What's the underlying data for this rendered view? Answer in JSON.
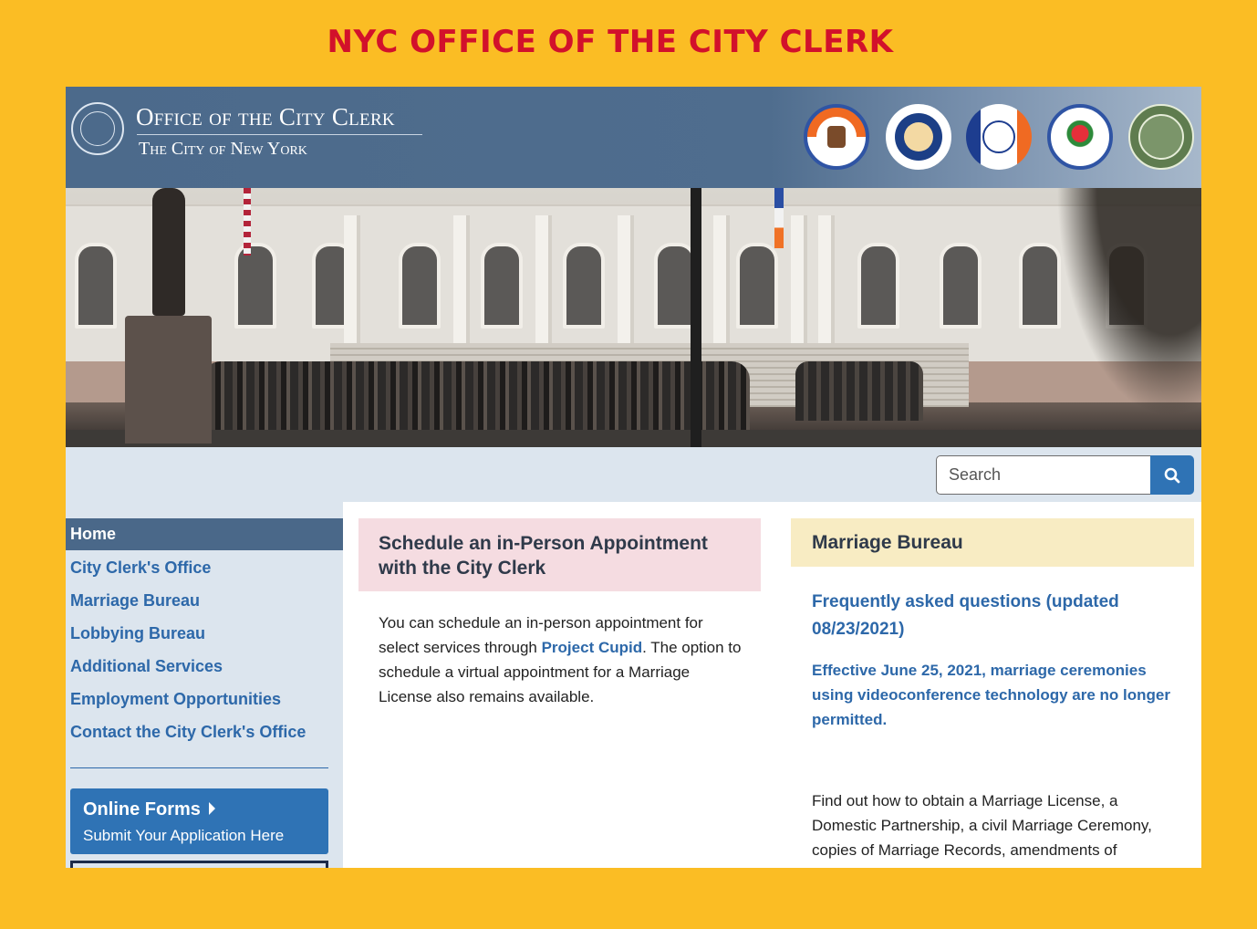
{
  "banner": {
    "title": "NYC OFFICE OF THE CITY CLERK"
  },
  "header": {
    "site_title": "Office of the City Clerk",
    "site_subtitle": "The City of New York",
    "borough_seals": [
      "bronx-seal-icon",
      "brooklyn-seal-icon",
      "manhattan-seal-icon",
      "queens-seal-icon",
      "staten-island-seal-icon"
    ]
  },
  "search": {
    "placeholder": "Search",
    "button_icon": "search-icon"
  },
  "sidebar": {
    "home": "Home",
    "items": [
      {
        "label": "City Clerk's Office"
      },
      {
        "label": "Marriage Bureau"
      },
      {
        "label": "Lobbying Bureau"
      },
      {
        "label": "Additional Services"
      },
      {
        "label": "Employment Opportunities"
      },
      {
        "label": "Contact the City Clerk's Office"
      }
    ],
    "online_forms": {
      "title": "Online Forms",
      "subtitle": "Submit Your Application Here"
    }
  },
  "appointment_card": {
    "title": "Schedule an in-Person Appointment with the City Clerk",
    "text_before": "You can schedule an in-person appointment for select services through ",
    "link": "Project Cupid",
    "text_after": ". The option to schedule a virtual appointment for a Marriage License also remains available."
  },
  "marriage_card": {
    "title": "Marriage Bureau",
    "faq_link": "Frequently asked questions (updated 08/23/2021)",
    "notice": "Effective June 25, 2021, marriage ceremonies using videoconference technology are no longer permitted.",
    "description": "Find out how to obtain a Marriage License, a Domestic Partnership, a civil Marriage Ceremony, copies of Marriage Records, amendments of"
  },
  "colors": {
    "frame": "#fbbd24",
    "banner_text": "#d2112b",
    "header": "#4c6a8b",
    "link": "#2d68a9",
    "button": "#2f73b5",
    "sidebar_bg": "#dce5ee"
  }
}
